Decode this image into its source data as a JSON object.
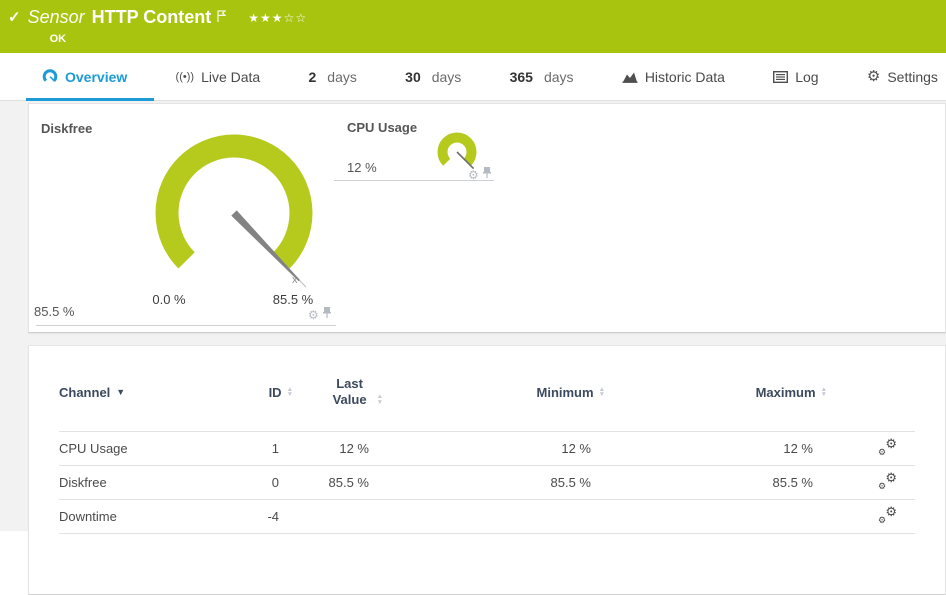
{
  "colors": {
    "status_green": "#a9c40f",
    "gauge_green": "#b5ca1d",
    "accent_blue": "#1d9bd6"
  },
  "icons": {
    "check": "✓",
    "live_data": "((•))",
    "gear": "⚙",
    "sort_asc": "▲",
    "sort_desc": "▼",
    "channel_sorted_desc": "▼"
  },
  "banner": {
    "kind": "Sensor",
    "title": "HTTP Content",
    "stars_filled": "★★★",
    "stars_empty": "☆☆",
    "status": "OK"
  },
  "tabs": {
    "overview": "Overview",
    "live_data": "Live Data",
    "days2_num": "2",
    "days2_unit": "days",
    "days30_num": "30",
    "days30_unit": "days",
    "days365_num": "365",
    "days365_unit": "days",
    "historic": "Historic Data",
    "log": "Log",
    "settings": "Settings"
  },
  "gauges": {
    "diskfree": {
      "title": "Diskfree",
      "value": "85.5 %",
      "scale_min": "0.0 %",
      "scale_max": "85.5 %",
      "avg_marker": "x̄"
    },
    "cpu": {
      "title": "CPU Usage",
      "value": "12 %"
    }
  },
  "chart_data": [
    {
      "type": "gauge",
      "title": "Diskfree",
      "value_pct": 85.5,
      "scale": [
        0.0,
        85.5
      ],
      "unit": "%",
      "average_marker_pct": 85.5
    },
    {
      "type": "gauge",
      "title": "CPU Usage",
      "value_pct": 12,
      "scale": [
        0,
        12
      ],
      "unit": "%"
    }
  ],
  "channel_table": {
    "headers": {
      "channel": "Channel",
      "id": "ID",
      "last_value": "Last Value",
      "minimum": "Minimum",
      "maximum": "Maximum"
    },
    "rows": [
      {
        "channel": "CPU Usage",
        "id": "1",
        "last": "12 %",
        "min": "12 %",
        "max": "12 %"
      },
      {
        "channel": "Diskfree",
        "id": "0",
        "last": "85.5 %",
        "min": "85.5 %",
        "max": "85.5 %"
      },
      {
        "channel": "Downtime",
        "id": "-4",
        "last": "",
        "min": "",
        "max": ""
      }
    ]
  }
}
